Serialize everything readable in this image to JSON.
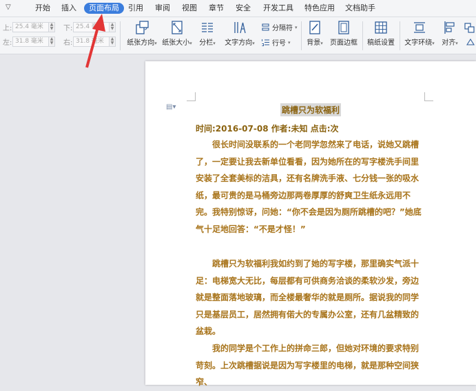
{
  "menu": {
    "tabs": [
      "开始",
      "插入",
      "页面布局",
      "引用",
      "审阅",
      "视图",
      "章节",
      "安全",
      "开发工具",
      "特色应用",
      "文档助手"
    ],
    "active": "页面布局"
  },
  "ribbon": {
    "margins": {
      "top_label": "上:",
      "top_value": "25.4 毫米",
      "bottom_label": "下:",
      "bottom_value": "25.4 毫米",
      "left_label": "左:",
      "left_value": "31.8 毫米",
      "right_label": "右:",
      "right_value": "31.8 毫米"
    },
    "orientation": "纸张方向",
    "size": "纸张大小",
    "columns": "分栏",
    "text_direction": "文字方向",
    "separator": "分隔符",
    "line_numbers": "行号",
    "background": "背景",
    "page_border": "页面边框",
    "grid_setup": "稿纸设置",
    "text_wrap": "文字环绕",
    "align": "对齐"
  },
  "document": {
    "title": "跳槽只为软福利",
    "meta": "时间:2016-07-08  作者:未知  点击:次",
    "paragraphs": [
      "很长时间没联系的一个老同学忽然来了电话，说她又跳槽了，一定要让我去新单位看看，因为她所在的写字楼洗手间里安装了全套美标的洁具，还有名牌洗手液、七分钱一张的吸水纸，最可贵的是马桶旁边那两卷厚厚的舒爽卫生纸永远用不完。我特别惊讶，问她：“你不会是因为厕所跳槽的吧？”她底气十足地回答：“不是才怪！”",
      "跳槽只为软福利我如约到了她的写字楼，那里确实气派十足：电梯宽大无比，每层都有可供商务洽谈的柔软沙发，旁边就是整面落地玻璃，而全楼最奢华的就是厕所。据说我的同学只是基层员工，居然拥有偌大的专属办公室，还有几盆精致的盆栽。",
      "我的同学是个工作上的拼命三郎，但她对环境的要求特别苛刻。上次跳槽据说是因为写字楼里的电梯，就是那种空间狭窄、"
    ]
  }
}
